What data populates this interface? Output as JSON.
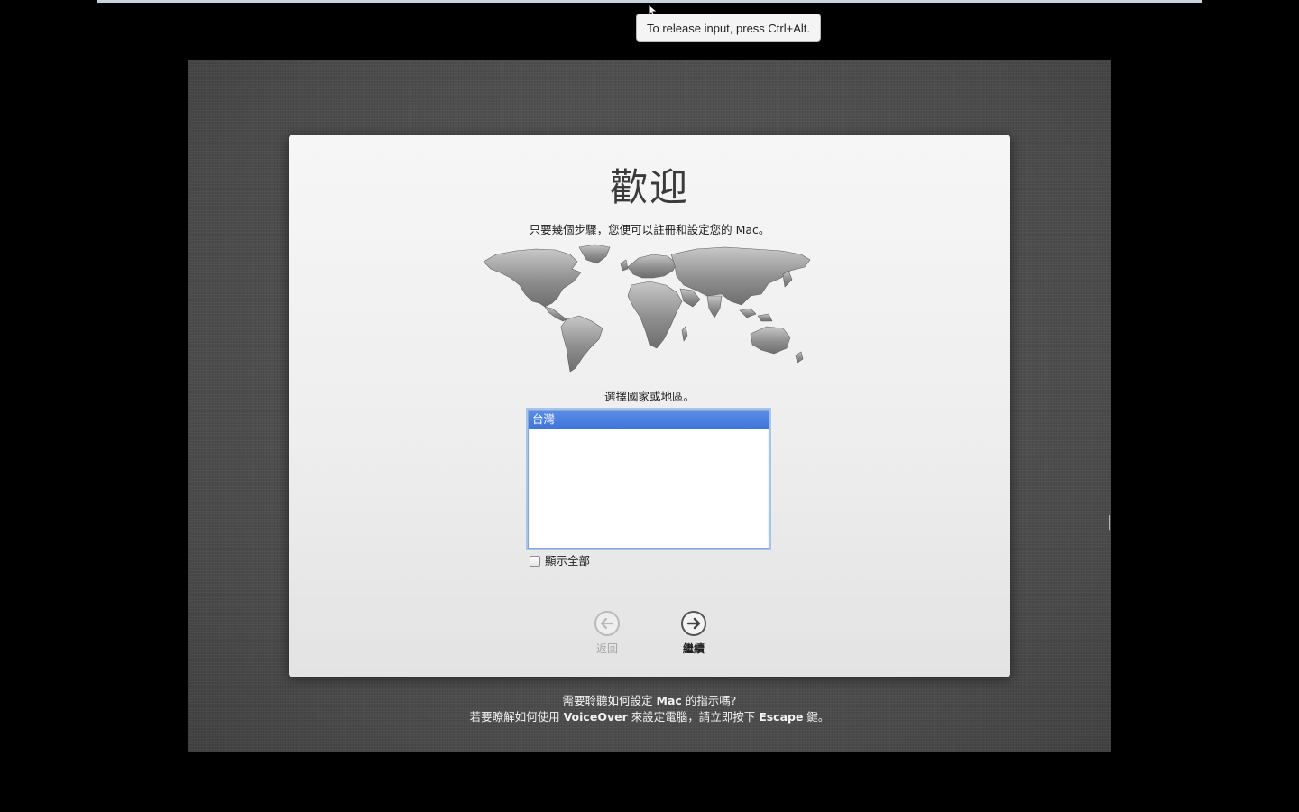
{
  "vm": {
    "release_hint": "To release input, press Ctrl+Alt."
  },
  "setup": {
    "title": "歡迎",
    "subtitle": "只要幾個步驟，您便可以註冊和設定您的 Mac。",
    "select_label": "選擇國家或地區。",
    "countries": [
      "台灣"
    ],
    "selected_country": "台灣",
    "show_all_label": "顯示全部",
    "show_all_checked": false,
    "back_label": "返回",
    "back_enabled": false,
    "continue_label": "繼續",
    "continue_enabled": true
  },
  "help": {
    "line1_pre": "需要聆聽如何設定 ",
    "line1_mac": "Mac",
    "line1_post": " 的指示嗎?",
    "line2_pre": "若要瞭解如何使用 ",
    "line2_voiceover": "VoiceOver",
    "line2_mid": " 來設定電腦，請立即按下 ",
    "line2_escape": "Escape",
    "line2_post": " 鍵。"
  },
  "colors": {
    "selection": "#3f74db",
    "panel": "#f0f0f0",
    "desktop": "#505050"
  }
}
